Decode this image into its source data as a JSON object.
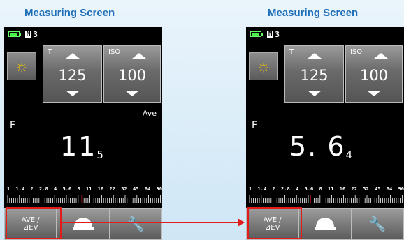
{
  "left_panel": {
    "caption": "Measuring Screen",
    "status": {
      "memory_label": "M",
      "memory_count": "3"
    },
    "mode_icon": "sun-icon",
    "shutter": {
      "label": "T",
      "value": "125"
    },
    "iso": {
      "label": "ISO",
      "value": "100"
    },
    "ave_tag": "Ave",
    "f_label": "F",
    "f_main": "11",
    "f_sub": "5",
    "scale": [
      "1",
      "1.4",
      "2",
      "2.8",
      "4",
      "5.6",
      "8",
      "11",
      "16",
      "22",
      "32",
      "45",
      "64",
      "90"
    ],
    "buttons": {
      "ave_line1": "AVE /",
      "ave_line2": "⊿EV"
    }
  },
  "right_panel": {
    "caption": "Measuring Screen",
    "status": {
      "memory_label": "M",
      "memory_count": "3"
    },
    "mode_icon": "sun-icon",
    "shutter": {
      "label": "T",
      "value": "125"
    },
    "iso": {
      "label": "ISO",
      "value": "100"
    },
    "f_label": "F",
    "f_main": "5. 6",
    "f_sub": "4",
    "scale": [
      "1",
      "1.4",
      "2",
      "2.8",
      "4",
      "5.6",
      "8",
      "11",
      "16",
      "22",
      "32",
      "45",
      "64",
      "90"
    ],
    "buttons": {
      "ave_line1": "AVE /",
      "ave_line2": "⊿EV"
    }
  },
  "colors": {
    "caption": "#1f6fb8",
    "highlight": "#e21b1b",
    "battery": "#4cf04c",
    "sun": "#f2c200"
  }
}
